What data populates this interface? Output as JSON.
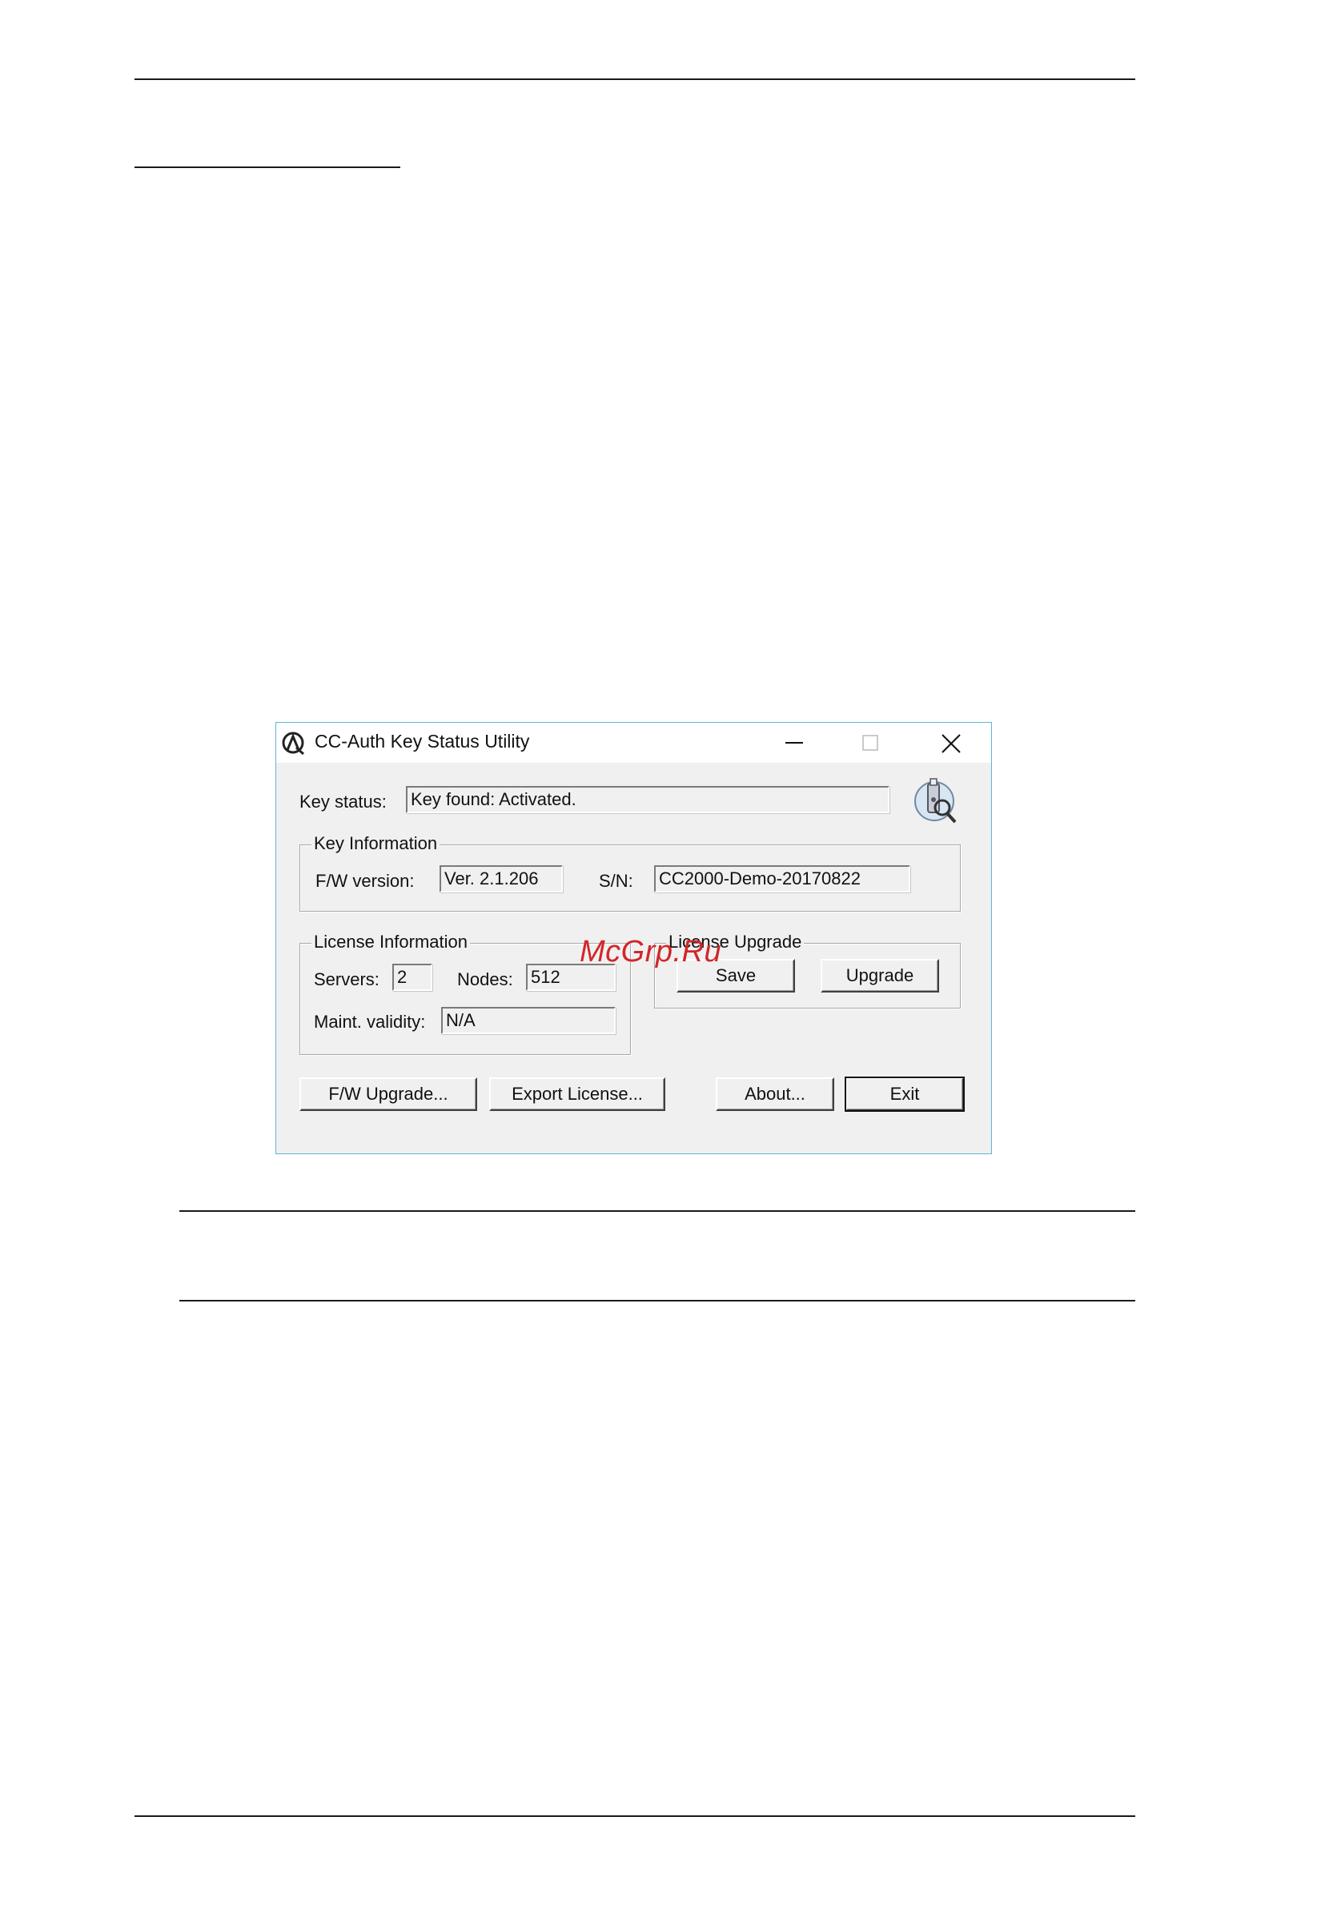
{
  "window": {
    "title": "CC-Auth Key Status Utility",
    "key_status_label": "Key status:",
    "key_status_value": "Key found: Activated.",
    "key_information": {
      "title": "Key Information",
      "fw_version_label": "F/W version:",
      "fw_version_value": "Ver. 2.1.206",
      "sn_label": "S/N:",
      "sn_value": "CC2000-Demo-20170822"
    },
    "license_information": {
      "title": "License Information",
      "servers_label": "Servers:",
      "servers_value": "2",
      "nodes_label": "Nodes:",
      "nodes_value": "512",
      "maint_label": "Maint. validity:",
      "maint_value": "N/A"
    },
    "license_upgrade": {
      "title": "License Upgrade",
      "save_label": "Save",
      "upgrade_label": "Upgrade"
    },
    "buttons": {
      "fw_upgrade": "F/W Upgrade...",
      "export_license": "Export License...",
      "about": "About...",
      "exit": "Exit"
    }
  },
  "watermark": "McGrp.Ru",
  "colors": {
    "window_border": "#5fb4d8",
    "dialog_bg": "#f0f0f0",
    "watermark": "#d2262a"
  }
}
